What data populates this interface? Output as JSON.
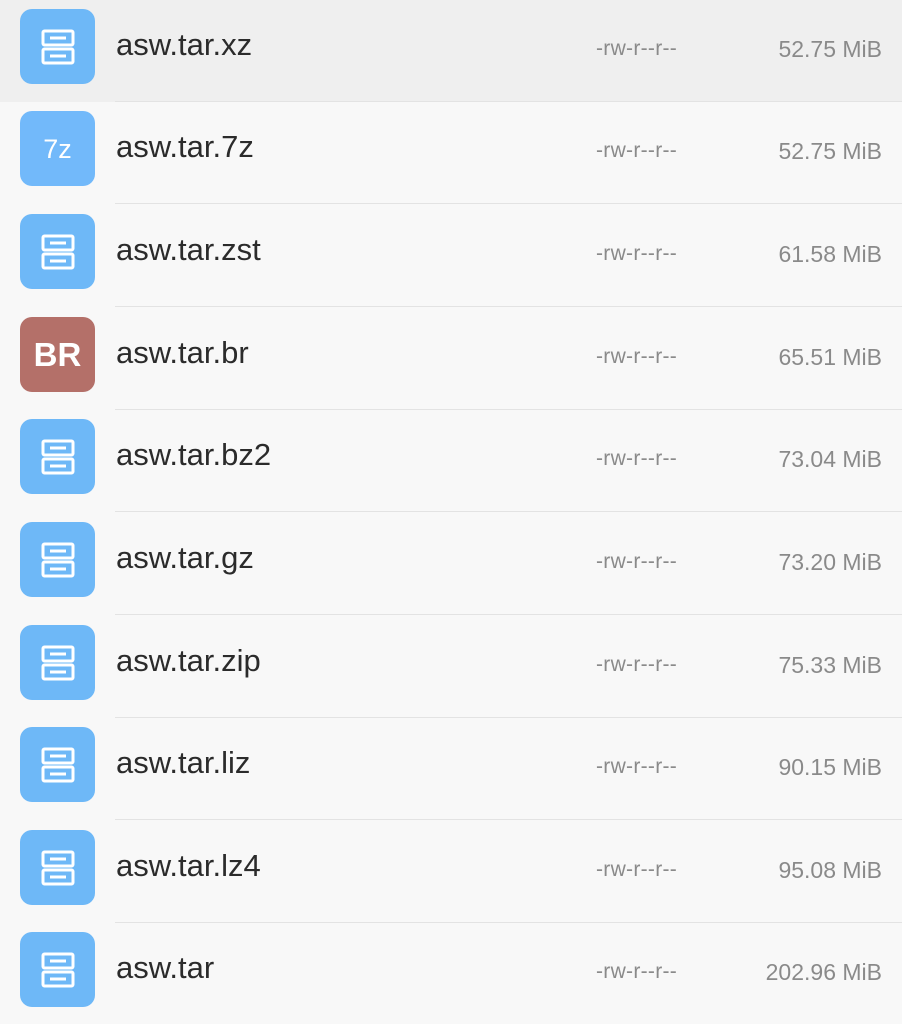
{
  "colors": {
    "archive_icon_bg": "#6eb8f7",
    "sevenzip_icon_bg": "#72b9fa",
    "brotli_icon_bg": "#b47069",
    "selected_row_bg": "#efefef",
    "row_bg": "#f8f8f8"
  },
  "files": [
    {
      "name": "asw.tar.xz",
      "perms": "-rw-r--r--",
      "size": "52.75 MiB",
      "icon": "archive-icon",
      "selected": true
    },
    {
      "name": "asw.tar.7z",
      "perms": "-rw-r--r--",
      "size": "52.75 MiB",
      "icon": "7z-icon",
      "icon_text": "7z"
    },
    {
      "name": "asw.tar.zst",
      "perms": "-rw-r--r--",
      "size": "61.58 MiB",
      "icon": "archive-icon"
    },
    {
      "name": "asw.tar.br",
      "perms": "-rw-r--r--",
      "size": "65.51 MiB",
      "icon": "brotli-icon",
      "icon_text": "BR"
    },
    {
      "name": "asw.tar.bz2",
      "perms": "-rw-r--r--",
      "size": "73.04 MiB",
      "icon": "archive-icon"
    },
    {
      "name": "asw.tar.gz",
      "perms": "-rw-r--r--",
      "size": "73.20 MiB",
      "icon": "archive-icon"
    },
    {
      "name": "asw.tar.zip",
      "perms": "-rw-r--r--",
      "size": "75.33 MiB",
      "icon": "archive-icon"
    },
    {
      "name": "asw.tar.liz",
      "perms": "-rw-r--r--",
      "size": "90.15 MiB",
      "icon": "archive-icon"
    },
    {
      "name": "asw.tar.lz4",
      "perms": "-rw-r--r--",
      "size": "95.08 MiB",
      "icon": "archive-icon"
    },
    {
      "name": "asw.tar",
      "perms": "-rw-r--r--",
      "size": "202.96 MiB",
      "icon": "archive-icon"
    }
  ]
}
